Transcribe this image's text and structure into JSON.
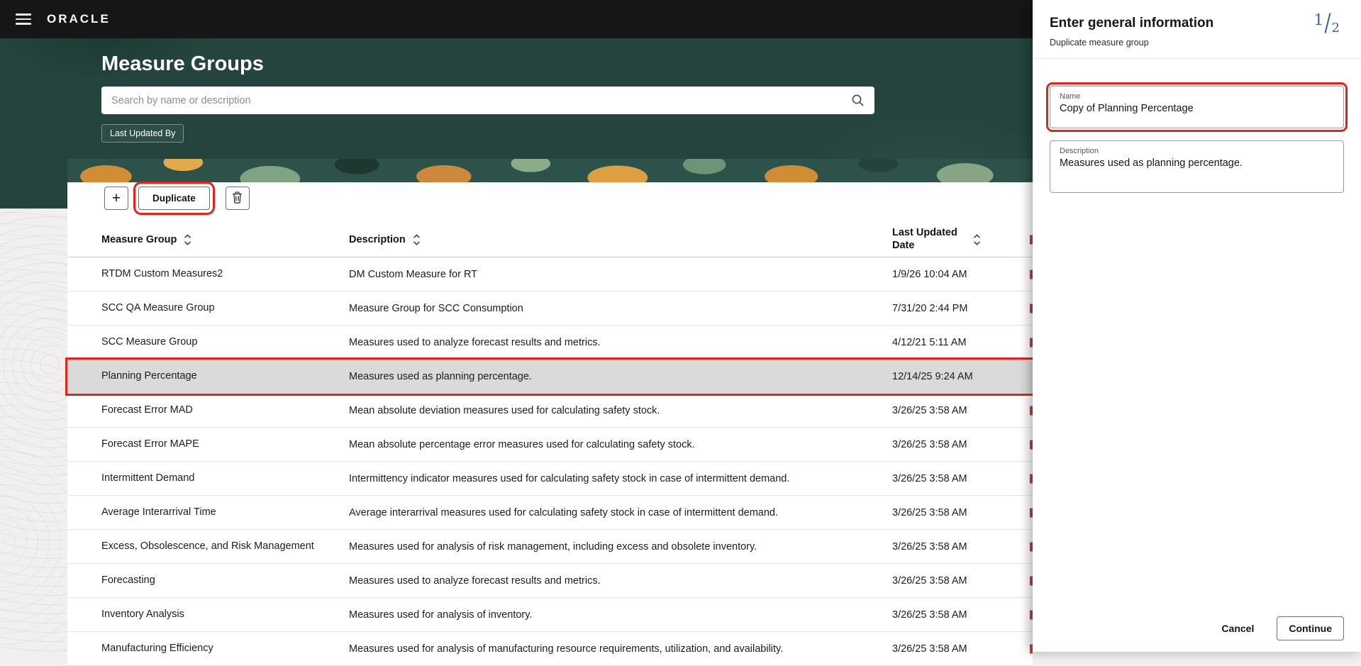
{
  "header": {
    "brand": "ORACLE"
  },
  "main": {
    "title": "Measure Groups",
    "search_placeholder": "Search by name or description",
    "filter_chip": "Last Updated By",
    "toolbar": {
      "add_label": "+",
      "duplicate_label": "Duplicate"
    },
    "table": {
      "columns": {
        "measure_group": "Measure Group",
        "description": "Description",
        "last_updated_date": "Last Updated Date"
      },
      "selected_row": "Planning Percentage",
      "rows": [
        {
          "measure_group": "RTDM Custom Measures2",
          "description": "DM Custom Measure for RT",
          "last_updated": "1/9/26 10:04 AM"
        },
        {
          "measure_group": "SCC QA Measure Group",
          "description": "Measure Group for SCC Consumption",
          "last_updated": "7/31/20 2:44 PM"
        },
        {
          "measure_group": "SCC Measure Group",
          "description": "Measures used to analyze forecast results and metrics.",
          "last_updated": "4/12/21 5:11 AM"
        },
        {
          "measure_group": "Planning Percentage",
          "description": "Measures used as planning percentage.",
          "last_updated": "12/14/25 9:24 AM"
        },
        {
          "measure_group": "Forecast Error MAD",
          "description": "Mean absolute deviation measures used for calculating safety stock.",
          "last_updated": "3/26/25 3:58 AM"
        },
        {
          "measure_group": "Forecast Error MAPE",
          "description": "Mean absolute percentage error measures used for calculating safety stock.",
          "last_updated": "3/26/25 3:58 AM"
        },
        {
          "measure_group": "Intermittent Demand",
          "description": "Intermittency indicator measures used for calculating safety stock in case of intermittent demand.",
          "last_updated": "3/26/25 3:58 AM"
        },
        {
          "measure_group": "Average Interarrival Time",
          "description": "Average interarrival measures used for calculating safety stock in case of intermittent demand.",
          "last_updated": "3/26/25 3:58 AM"
        },
        {
          "measure_group": "Excess, Obsolescence, and Risk Management",
          "description": "Measures used for analysis of risk management, including excess and obsolete inventory.",
          "last_updated": "3/26/25 3:58 AM"
        },
        {
          "measure_group": "Forecasting",
          "description": "Measures used to analyze forecast results and metrics.",
          "last_updated": "3/26/25 3:58 AM"
        },
        {
          "measure_group": "Inventory Analysis",
          "description": "Measures used for analysis of inventory.",
          "last_updated": "3/26/25 3:58 AM"
        },
        {
          "measure_group": "Manufacturing Efficiency",
          "description": "Measures used for analysis of manufacturing resource requirements, utilization, and availability.",
          "last_updated": "3/26/25 3:58 AM"
        }
      ]
    }
  },
  "panel": {
    "title": "Enter general information",
    "subtitle": "Duplicate measure group",
    "step_current": "1",
    "step_total": "2",
    "name_field": {
      "label": "Name",
      "value": "Copy of Planning Percentage"
    },
    "description_field": {
      "label": "Description",
      "value": "Measures used as planning percentage."
    },
    "cancel_label": "Cancel",
    "continue_label": "Continue"
  },
  "colors": {
    "annotation": "#e1251d",
    "topbar_bg": "#161616",
    "hero_teal": "#24443d",
    "selected_row_bg": "#dadada"
  }
}
